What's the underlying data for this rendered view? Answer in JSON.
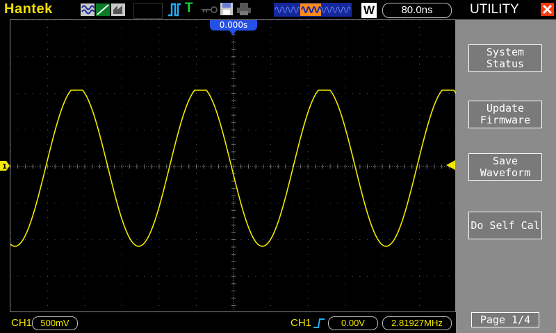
{
  "header": {
    "brand": "Hantek",
    "trigger_mode_letter": "T",
    "memory_label": "W",
    "timebase": "80.0ns",
    "icons": [
      "acquire-sample-icon",
      "acquire-peak-icon",
      "acquire-average-icon",
      "pulse-trigger-icon",
      "key-lock-icon",
      "save-disk-icon",
      "printer-icon",
      "memory-depth-bar"
    ]
  },
  "scope": {
    "trigger_position": "0.000s",
    "channel_marker": "1",
    "trace_color": "#f2e800",
    "grid_color": "#5a5a5a"
  },
  "footer": {
    "ch1_label": "CH1",
    "ch1_scale": "500mV",
    "trigger_source": "CH1",
    "trigger_level": "0.00V",
    "frequency": "2.81927MHz"
  },
  "menu": {
    "title": "UTILITY",
    "buttons": [
      {
        "label": "System\nStatus"
      },
      {
        "label": "Update\nFirmware"
      },
      {
        "label": "Save\nWaveform"
      },
      {
        "label": "Do Self Cal"
      }
    ],
    "page": "Page 1/4"
  },
  "colors": {
    "brand": "#f0e000",
    "accent_blue": "#2550e6",
    "close_red": "#ff3a10",
    "menu_bg": "#8b8b8b"
  }
}
